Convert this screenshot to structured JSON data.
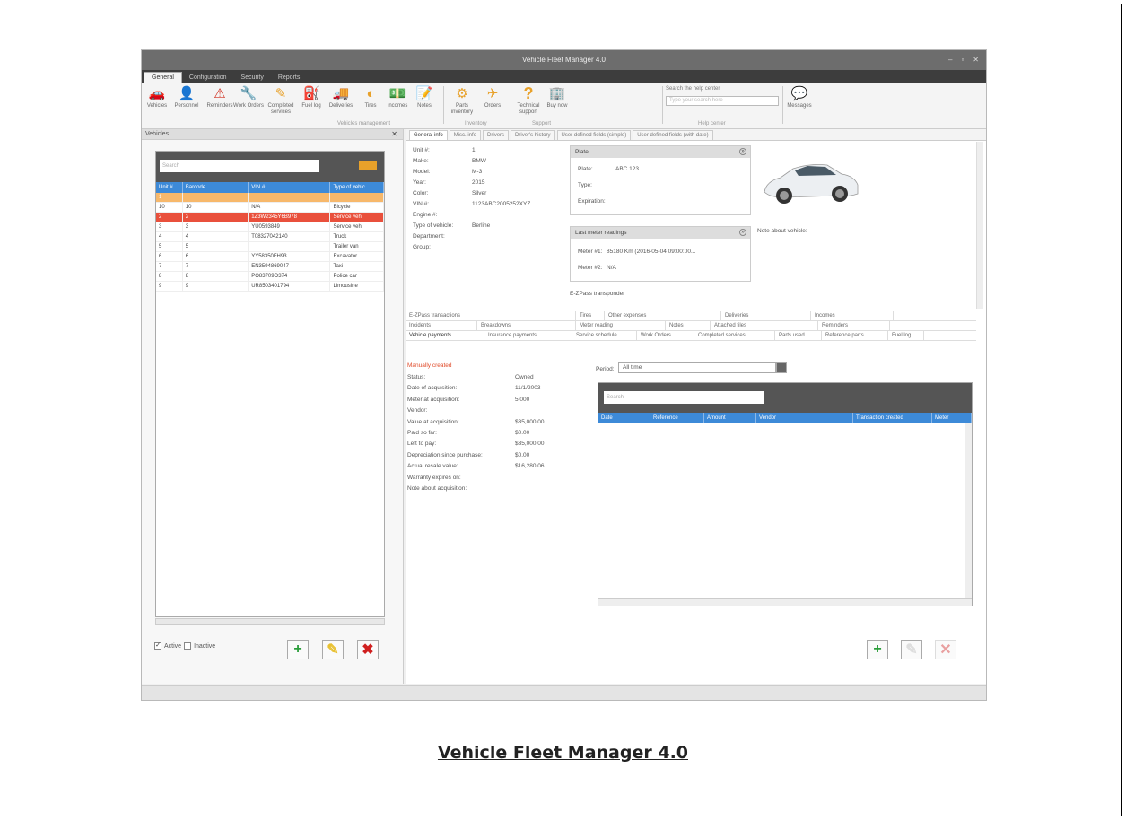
{
  "window": {
    "title": "Vehicle Fleet Manager 4.0",
    "controls": [
      "–",
      "▫",
      "✕"
    ]
  },
  "menu": [
    "General",
    "Configuration",
    "Security",
    "Reports"
  ],
  "ribbon": {
    "buttons": [
      {
        "label": "Vehicles",
        "icon": "car-icon",
        "glyph": "🚗"
      },
      {
        "label": "Personnel",
        "icon": "person-icon",
        "glyph": "👤"
      },
      {
        "label": "Reminders",
        "icon": "warning-icon",
        "glyph": "⚠"
      },
      {
        "label": "Work Orders",
        "icon": "work-order-icon",
        "glyph": "🔧"
      },
      {
        "label": "Completed services",
        "icon": "completed-services-icon",
        "glyph": "✎"
      },
      {
        "label": "Fuel log",
        "icon": "fuel-icon",
        "glyph": "⛽"
      },
      {
        "label": "Deliveries",
        "icon": "truck-icon",
        "glyph": "🚚"
      },
      {
        "label": "Tires",
        "icon": "tire-icon",
        "glyph": "◐"
      },
      {
        "label": "Incomes",
        "icon": "incomes-icon",
        "glyph": "💵"
      },
      {
        "label": "Notes",
        "icon": "notes-icon",
        "glyph": "📝"
      },
      {
        "label": "Parts inventory",
        "icon": "parts-icon",
        "glyph": "⚙"
      },
      {
        "label": "Orders",
        "icon": "orders-icon",
        "glyph": "✈"
      },
      {
        "label": "Technical support",
        "icon": "question-icon",
        "glyph": "?"
      },
      {
        "label": "Buy now",
        "icon": "buy-icon",
        "glyph": "🏢"
      },
      {
        "label": "Messages",
        "icon": "chat-icon",
        "glyph": "💬"
      }
    ],
    "groups": [
      "Vehicles management",
      "Inventory",
      "Support",
      "Help center"
    ],
    "help": {
      "label": "Search the help center",
      "placeholder": "Type your search here"
    }
  },
  "left_panel": {
    "title": "Vehicles",
    "search_placeholder": "Search",
    "columns": [
      "Unit #",
      "Barcode",
      "VIN #",
      "Type of vehic"
    ],
    "rows": [
      [
        "1",
        "",
        "",
        ""
      ],
      [
        "10",
        "10",
        "N/A",
        "Bicycle"
      ],
      [
        "2",
        "2",
        "1Z3W2345Y6B978",
        "Service veh"
      ],
      [
        "3",
        "3",
        "YU0593849",
        "Service veh"
      ],
      [
        "4",
        "4",
        "T08327042140",
        "Truck"
      ],
      [
        "5",
        "5",
        "",
        "Trailer van"
      ],
      [
        "6",
        "6",
        "YY58350FH93",
        "Excavator"
      ],
      [
        "7",
        "7",
        "EN3594869047",
        "Taxi"
      ],
      [
        "8",
        "8",
        "PO83709O374",
        "Police car"
      ],
      [
        "9",
        "9",
        "UR8503401794",
        "Limousine"
      ]
    ],
    "active_label": "Active",
    "inactive_label": "Inactive"
  },
  "tabs": [
    "General info",
    "Misc. info",
    "Drivers",
    "Driver's history",
    "User defined fields (simple)",
    "User defined fields (with date)"
  ],
  "general": {
    "fields": [
      {
        "label": "Unit #:",
        "value": "1"
      },
      {
        "label": "Make:",
        "value": "BMW"
      },
      {
        "label": "Model:",
        "value": "M-3"
      },
      {
        "label": "Year:",
        "value": "2015"
      },
      {
        "label": "Color:",
        "value": "Silver"
      },
      {
        "label": "VIN #:",
        "value": "1123ABC2005252XYZ"
      },
      {
        "label": "Engine #:",
        "value": ""
      },
      {
        "label": "Type of vehicle:",
        "value": "Berline"
      },
      {
        "label": "Department:",
        "value": ""
      },
      {
        "label": "Group:",
        "value": ""
      }
    ],
    "plate_box": {
      "title": "Plate",
      "plate_label": "Plate:",
      "plate_value": "ABC 123",
      "type_label": "Type:",
      "expiration_label": "Expiration:"
    },
    "meter_box": {
      "title": "Last meter readings",
      "meter1_label": "Meter #1:",
      "meter1_value": "85180 Km (2016-05-04 09:00:00...",
      "meter2_label": "Meter #2:",
      "meter2_value": "N/A"
    },
    "ezpass": "E-ZPass transponder",
    "note_vehicle": "Note about vehicle:"
  },
  "sub_tabs": {
    "row1": [
      "E-ZPass transactions",
      "Tires",
      "Other expenses",
      "Deliveries",
      "Incomes"
    ],
    "row2": [
      "Incidents",
      "Breakdowns",
      "Meter reading",
      "Notes",
      "Attached files",
      "Reminders"
    ],
    "row3": [
      "Vehicle payments",
      "Insurance payments",
      "Service schedule",
      "Work Orders",
      "Completed services",
      "Parts used",
      "Reference parts",
      "Fuel log"
    ]
  },
  "acquisition": {
    "title": "Manually created",
    "rows": [
      {
        "label": "Status:",
        "value": "Owned"
      },
      {
        "label": "Date of acquisition:",
        "value": "11/1/2003"
      },
      {
        "label": "Meter at acquisition:",
        "value": "5,000"
      },
      {
        "label": "Vendor:",
        "value": ""
      },
      {
        "label": "Value at acquisition:",
        "value": "$35,000.00"
      },
      {
        "label": "Paid so far:",
        "value": "$0.00"
      },
      {
        "label": "Left to pay:",
        "value": "$35,000.00"
      },
      {
        "label": "Depreciation since purchase:",
        "value": "$0.00"
      },
      {
        "label": "Actual resale value:",
        "value": "$16,280.06"
      },
      {
        "label": "Warranty expires on:",
        "value": ""
      },
      {
        "label": "Note about acquisition:",
        "value": ""
      }
    ]
  },
  "payments": {
    "period_label": "Period:",
    "period_value": "All time",
    "search_placeholder": "Search",
    "columns": [
      "Date",
      "Reference",
      "Amount",
      "Vendor",
      "Transaction created",
      "Meter"
    ]
  }
}
